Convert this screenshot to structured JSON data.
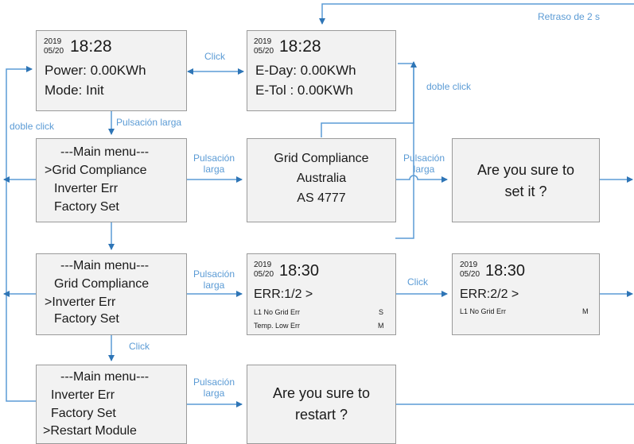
{
  "accent_color": "#5b9bd5",
  "box_fill": "#f2f2f2",
  "screen1": {
    "year": "2019",
    "date": "05/20",
    "time": "18:28",
    "line1": "Power: 0.00KWh",
    "line2": "Mode: Init"
  },
  "screen2": {
    "year": "2019",
    "date": "05/20",
    "time": "18:28",
    "line1": "E-Day: 0.00KWh",
    "line2": "E-Tol : 0.00KWh"
  },
  "menu1": {
    "l1": "---Main menu---",
    "l2": ">Grid Compliance",
    "l3": "Inverter Err",
    "l4": "Factory Set"
  },
  "grid": {
    "l1": "Grid Compliance",
    "l2": "Australia",
    "l3": "AS 4777"
  },
  "confirm1": {
    "l1": "Are you sure to",
    "l2": "set it ?"
  },
  "menu2": {
    "l1": "---Main menu---",
    "l2": "Grid Compliance",
    "l3": ">Inverter Err",
    "l4": "Factory Set"
  },
  "err1": {
    "year": "2019",
    "date": "05/20",
    "time": "18:30",
    "header": "ERR:1/2  >",
    "e1": "L1 No Grid Err",
    "e1c": "S",
    "e2": "Temp. Low Err",
    "e2c": "M"
  },
  "err2": {
    "year": "2019",
    "date": "05/20",
    "time": "18:30",
    "header": "ERR:2/2  >",
    "e1": "L1 No Grid Err",
    "e1c": "M"
  },
  "menu3": {
    "l1": "---Main menu---",
    "l2": "Inverter Err",
    "l3": "Factory Set",
    "l4": ">Restart Module"
  },
  "confirm2": {
    "l1": "Are you sure to",
    "l2": "restart ?"
  },
  "labels": {
    "delay": "Retraso de 2 s",
    "click": "Click",
    "double_click": "doble click",
    "long_press": "Pulsación larga",
    "long_press_a": "Pulsación",
    "long_press_b": "larga"
  }
}
